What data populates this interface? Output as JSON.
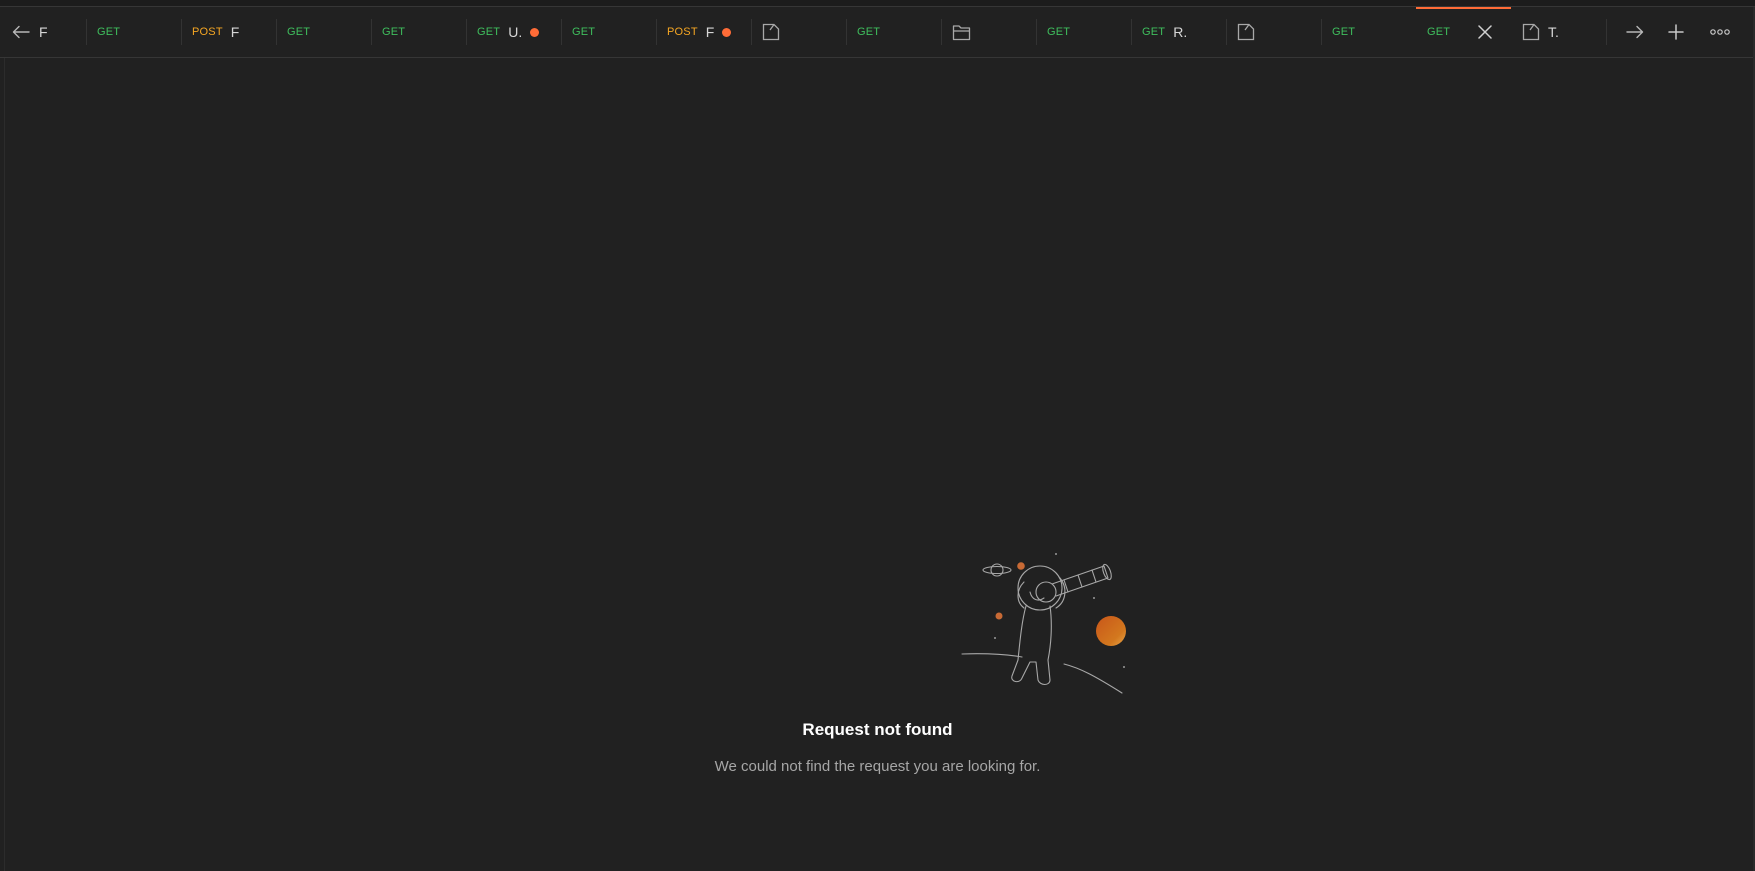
{
  "tabs": [
    {
      "method": "",
      "name": "F",
      "icon": "back-arrow-icon"
    },
    {
      "method": "GET",
      "name": ""
    },
    {
      "method": "POST",
      "name": "F"
    },
    {
      "method": "GET",
      "name": ""
    },
    {
      "method": "GET",
      "name": ""
    },
    {
      "method": "GET",
      "name": "U.",
      "unsaved": true
    },
    {
      "method": "GET",
      "name": ""
    },
    {
      "method": "POST",
      "name": "F",
      "unsaved": true
    },
    {
      "method": "",
      "name": "",
      "icon": "document-icon"
    },
    {
      "method": "GET",
      "name": ""
    },
    {
      "method": "",
      "name": "",
      "icon": "folder-icon"
    },
    {
      "method": "GET",
      "name": ""
    },
    {
      "method": "GET",
      "name": "R."
    },
    {
      "method": "",
      "name": "",
      "icon": "document-icon"
    },
    {
      "method": "GET",
      "name": ""
    },
    {
      "method": "GET",
      "name": "",
      "active": true
    },
    {
      "method": "",
      "name": "T.",
      "icon": "document-icon"
    }
  ],
  "tab_text": {
    "t0": "F",
    "t1": "GET",
    "t2m": "POST",
    "t2n": "F",
    "t3": "GET",
    "t4": "GET",
    "t5m": "GET",
    "t5n": "U.",
    "t6": "GET",
    "t7m": "POST",
    "t7n": "F",
    "t9": "GET",
    "t11": "GET",
    "t12m": "GET",
    "t12n": "R.",
    "t14": "GET",
    "t15": "GET",
    "t16n": "T."
  },
  "toolbar": {
    "back_icon": "arrow-left-icon",
    "forward_icon": "arrow-right-icon",
    "new_tab_icon": "plus-icon",
    "more_icon": "ellipsis-icon"
  },
  "empty_state": {
    "title": "Request not found",
    "subtitle": "We could not find the request you are looking for."
  },
  "colors": {
    "background": "#212121",
    "accent": "#ff6c37",
    "get": "#3fbf5d",
    "post": "#f5a623"
  }
}
